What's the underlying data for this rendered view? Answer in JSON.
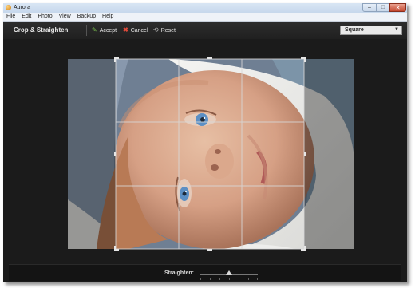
{
  "window": {
    "title": "Aurora"
  },
  "menu": [
    "File",
    "Edit",
    "Photo",
    "View",
    "Backup",
    "Help"
  ],
  "toolbar": {
    "title": "Crop & Straighten",
    "accept": "Accept",
    "cancel": "Cancel",
    "reset": "Reset",
    "aspect": {
      "value": "Square"
    }
  },
  "photo": {
    "subject": "baby face close-up"
  },
  "crop": {
    "overlay": "rule-of-thirds"
  },
  "straighten": {
    "label": "Straighten:",
    "value_fraction": 0.5
  },
  "colors": {
    "accept": "#7ec850",
    "cancel": "#e04a3a",
    "background": "#1b1b1b"
  }
}
